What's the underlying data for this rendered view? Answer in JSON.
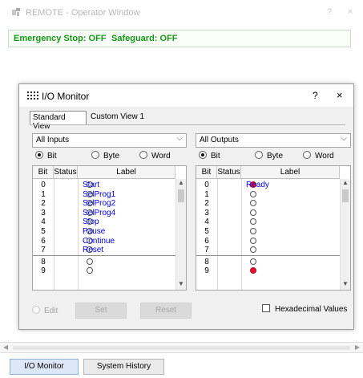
{
  "window": {
    "title": "REMOTE - Operator Window",
    "help_label": "?",
    "close_label": "×"
  },
  "status": {
    "emergency_stop": "Emergency Stop: OFF",
    "safeguard": "Safeguard: OFF",
    "color": "#139913"
  },
  "dialog": {
    "title": "I/O Monitor",
    "help_label": "?",
    "close_label": "×",
    "tabs": [
      "Standard View",
      "Custom View 1"
    ],
    "inputs": {
      "selected": "All Inputs",
      "radios": [
        "Bit",
        "Byte",
        "Word"
      ],
      "selected_radio": "Bit",
      "columns": [
        "Bit",
        "Status",
        "Label"
      ],
      "rows": [
        {
          "bit": "0",
          "label": "Start",
          "on": false
        },
        {
          "bit": "1",
          "label": "SelProg1",
          "on": false
        },
        {
          "bit": "2",
          "label": "SelProg2",
          "on": false
        },
        {
          "bit": "3",
          "label": "SelProg4",
          "on": false
        },
        {
          "bit": "4",
          "label": "Stop",
          "on": false
        },
        {
          "bit": "5",
          "label": "Pause",
          "on": false
        },
        {
          "bit": "6",
          "label": "Continue",
          "on": false
        },
        {
          "bit": "7",
          "label": "Reset",
          "on": false
        },
        {
          "bit": "8",
          "label": "",
          "on": false
        },
        {
          "bit": "9",
          "label": "",
          "on": false
        }
      ]
    },
    "outputs": {
      "selected": "All Outputs",
      "radios": [
        "Bit",
        "Byte",
        "Word"
      ],
      "selected_radio": "Bit",
      "columns": [
        "Bit",
        "Status",
        "Label"
      ],
      "rows": [
        {
          "bit": "0",
          "label": "Ready",
          "on": true
        },
        {
          "bit": "1",
          "label": "",
          "on": false
        },
        {
          "bit": "2",
          "label": "",
          "on": false
        },
        {
          "bit": "3",
          "label": "",
          "on": false
        },
        {
          "bit": "4",
          "label": "",
          "on": false
        },
        {
          "bit": "5",
          "label": "",
          "on": false
        },
        {
          "bit": "6",
          "label": "",
          "on": false
        },
        {
          "bit": "7",
          "label": "",
          "on": false
        },
        {
          "bit": "8",
          "label": "",
          "on": false
        },
        {
          "bit": "9",
          "label": "",
          "on": true
        }
      ]
    },
    "edit_label": "Edit",
    "set_label": "Set",
    "reset_label": "Reset",
    "hex_label": "Hexadecimal Values"
  },
  "bottom_tabs": [
    "I/O Monitor",
    "System History"
  ],
  "colors": {
    "label_text": "#0000ee",
    "status_on": "#e8122a"
  }
}
